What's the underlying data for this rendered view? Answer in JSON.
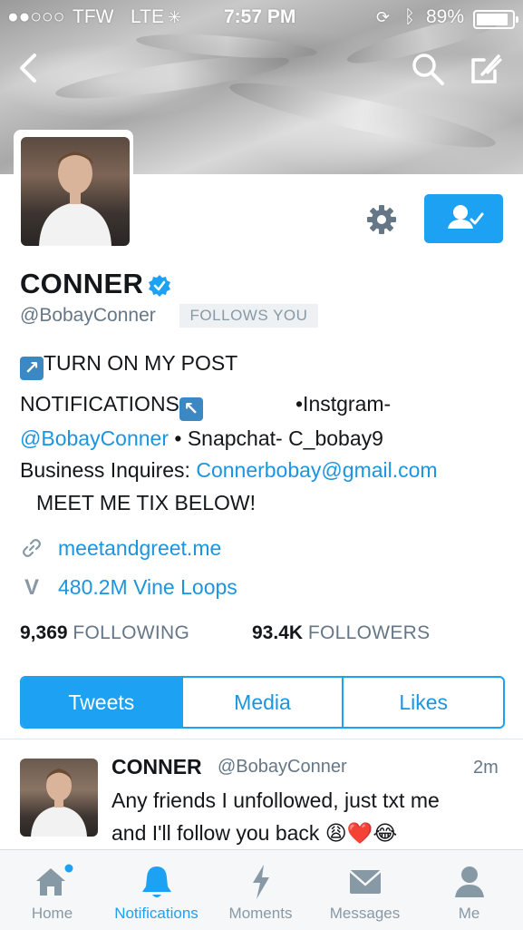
{
  "status_bar": {
    "carrier": "TFW",
    "network": "LTE",
    "time": "7:57 PM",
    "battery": "89%",
    "battery_level": 0.89
  },
  "profile": {
    "name": "CONNER",
    "handle": "@BobayConner",
    "follows_you": "FOLLOWS YOU",
    "verified": true,
    "bio": {
      "line1": "TURN ON MY POST",
      "line2a": "NOTIFICATIONS",
      "line2b": "•Instgram-",
      "line3a": "@BobayConner",
      "line3b": " • Snapchat- C_bobay9",
      "line4a": "Business Inquires: ",
      "line4b": "Connerbobay@gmail.com",
      "line5": "MEET ME TIX BELOW!"
    },
    "website": "meetandgreet.me",
    "vine_loops": "480.2M Vine Loops",
    "following_count": "9,369",
    "following_label": "FOLLOWING",
    "followers_count": "93.4K",
    "followers_label": "FOLLOWERS"
  },
  "tabs": [
    "Tweets",
    "Media",
    "Likes"
  ],
  "tweet": {
    "name": "CONNER",
    "handle": "@BobayConner",
    "time": "2m",
    "line1": "Any friends I unfollowed, just txt me",
    "line2": "and I'll follow you back",
    "emojis": "😩❤️😂"
  },
  "tabbar": {
    "items": [
      {
        "label": "Home",
        "icon": "home-icon"
      },
      {
        "label": "Notifications",
        "icon": "bell-icon"
      },
      {
        "label": "Moments",
        "icon": "lightning-icon"
      },
      {
        "label": "Messages",
        "icon": "envelope-icon"
      },
      {
        "label": "Me",
        "icon": "person-icon"
      }
    ],
    "active": "Notifications"
  },
  "colors": {
    "accent": "#1da1f2",
    "link": "#1b95e0",
    "muted": "#657786"
  }
}
